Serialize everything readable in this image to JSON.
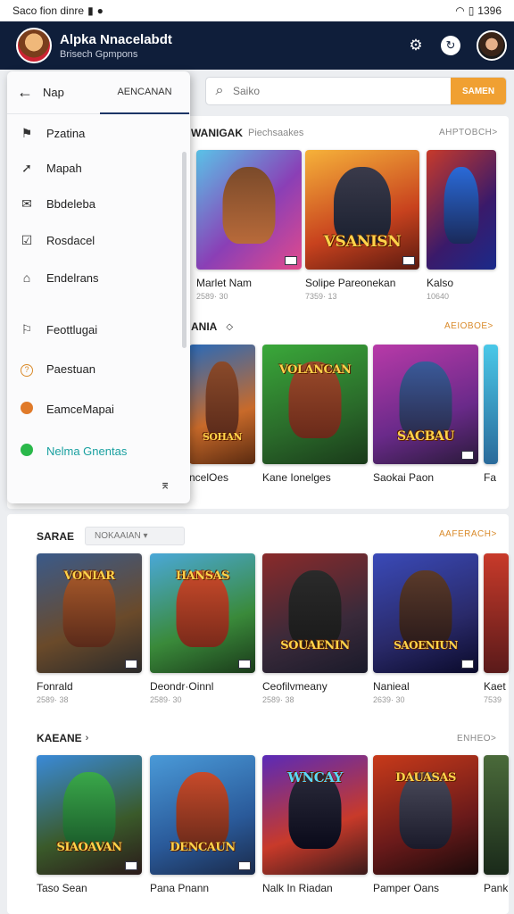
{
  "status": {
    "left": "Saco fion dinre",
    "right": "1396"
  },
  "app": {
    "title": "Alpka Nnacelabdt",
    "subtitle": "Brisech Gpmpons"
  },
  "search": {
    "placeholder": "Saiko",
    "button": "SAMEN"
  },
  "drawer": {
    "title": "Nap",
    "tab": "AENCANAN",
    "items": [
      {
        "label": "Pzatina",
        "icon": "flag-icon"
      },
      {
        "label": "Mapah",
        "icon": "arrow-icon"
      },
      {
        "label": "Bbdeleba",
        "icon": "mail-icon"
      },
      {
        "label": "Rosdacel",
        "icon": "checkbox-icon"
      },
      {
        "label": "Endelrans",
        "icon": "home-icon"
      },
      {
        "label": "Feottlugai",
        "icon": "flag-icon"
      },
      {
        "label": "Paestuan",
        "icon": "coin-icon"
      },
      {
        "label": "EamceMapai",
        "icon": "orange-dot-icon"
      },
      {
        "label": "Nelma Gnentas",
        "icon": "green-dot-icon"
      }
    ]
  },
  "sections": [
    {
      "title": "WANIGAK",
      "subtitle": "Piechsaakes",
      "see_all": "AHPTOBCH>",
      "tiles": [
        {
          "name": "Marlet Nam",
          "meta": "2589· 30",
          "logo": ""
        },
        {
          "name": "Solipe Pareonekan",
          "meta": "7359· 13",
          "logo": "VSANISN"
        },
        {
          "name": "Kalso",
          "meta": "10640",
          "logo": ""
        }
      ]
    },
    {
      "title": "ANIA",
      "subtitle": "",
      "see_all": "AEIOBOE>",
      "tiles": [
        {
          "name": "ncelOes",
          "meta": "",
          "logo": "SOHAN"
        },
        {
          "name": "Kane Ionelges",
          "meta": "",
          "logo": "VOLANCAN"
        },
        {
          "name": "Saokai Paon",
          "meta": "",
          "logo": "SACBAU"
        },
        {
          "name": "Fa",
          "meta": "",
          "logo": ""
        }
      ]
    },
    {
      "title": "SARAE",
      "subtitle": "",
      "pill": "NOKAAIAN",
      "see_all": "AAFERACH>",
      "tiles": [
        {
          "name": "Fonrald",
          "meta": "2589· 38",
          "logo": "VONIAR"
        },
        {
          "name": "Deondr·Oinnl",
          "meta": "2589· 30",
          "logo": "HANSAS"
        },
        {
          "name": "Ceofilvmeany",
          "meta": "2589· 38",
          "logo": "SOUAENIN"
        },
        {
          "name": "Nanieal",
          "meta": "2639· 30",
          "logo": "SAOENIUN"
        },
        {
          "name": "Kaet",
          "meta": "7539",
          "logo": ""
        }
      ]
    },
    {
      "title": "KAEANE",
      "subtitle": "",
      "see_all": "ENHEO>",
      "tiles": [
        {
          "name": "Taso Sean",
          "meta": "",
          "logo": "SIAOAVAN"
        },
        {
          "name": "Pana Pnann",
          "meta": "",
          "logo": "DENCAUN"
        },
        {
          "name": "Nalk In Riadan",
          "meta": "",
          "logo": "WNCAY"
        },
        {
          "name": "Pamper Oans",
          "meta": "",
          "logo": "DAUASAS"
        },
        {
          "name": "Pank",
          "meta": "",
          "logo": ""
        }
      ]
    }
  ]
}
